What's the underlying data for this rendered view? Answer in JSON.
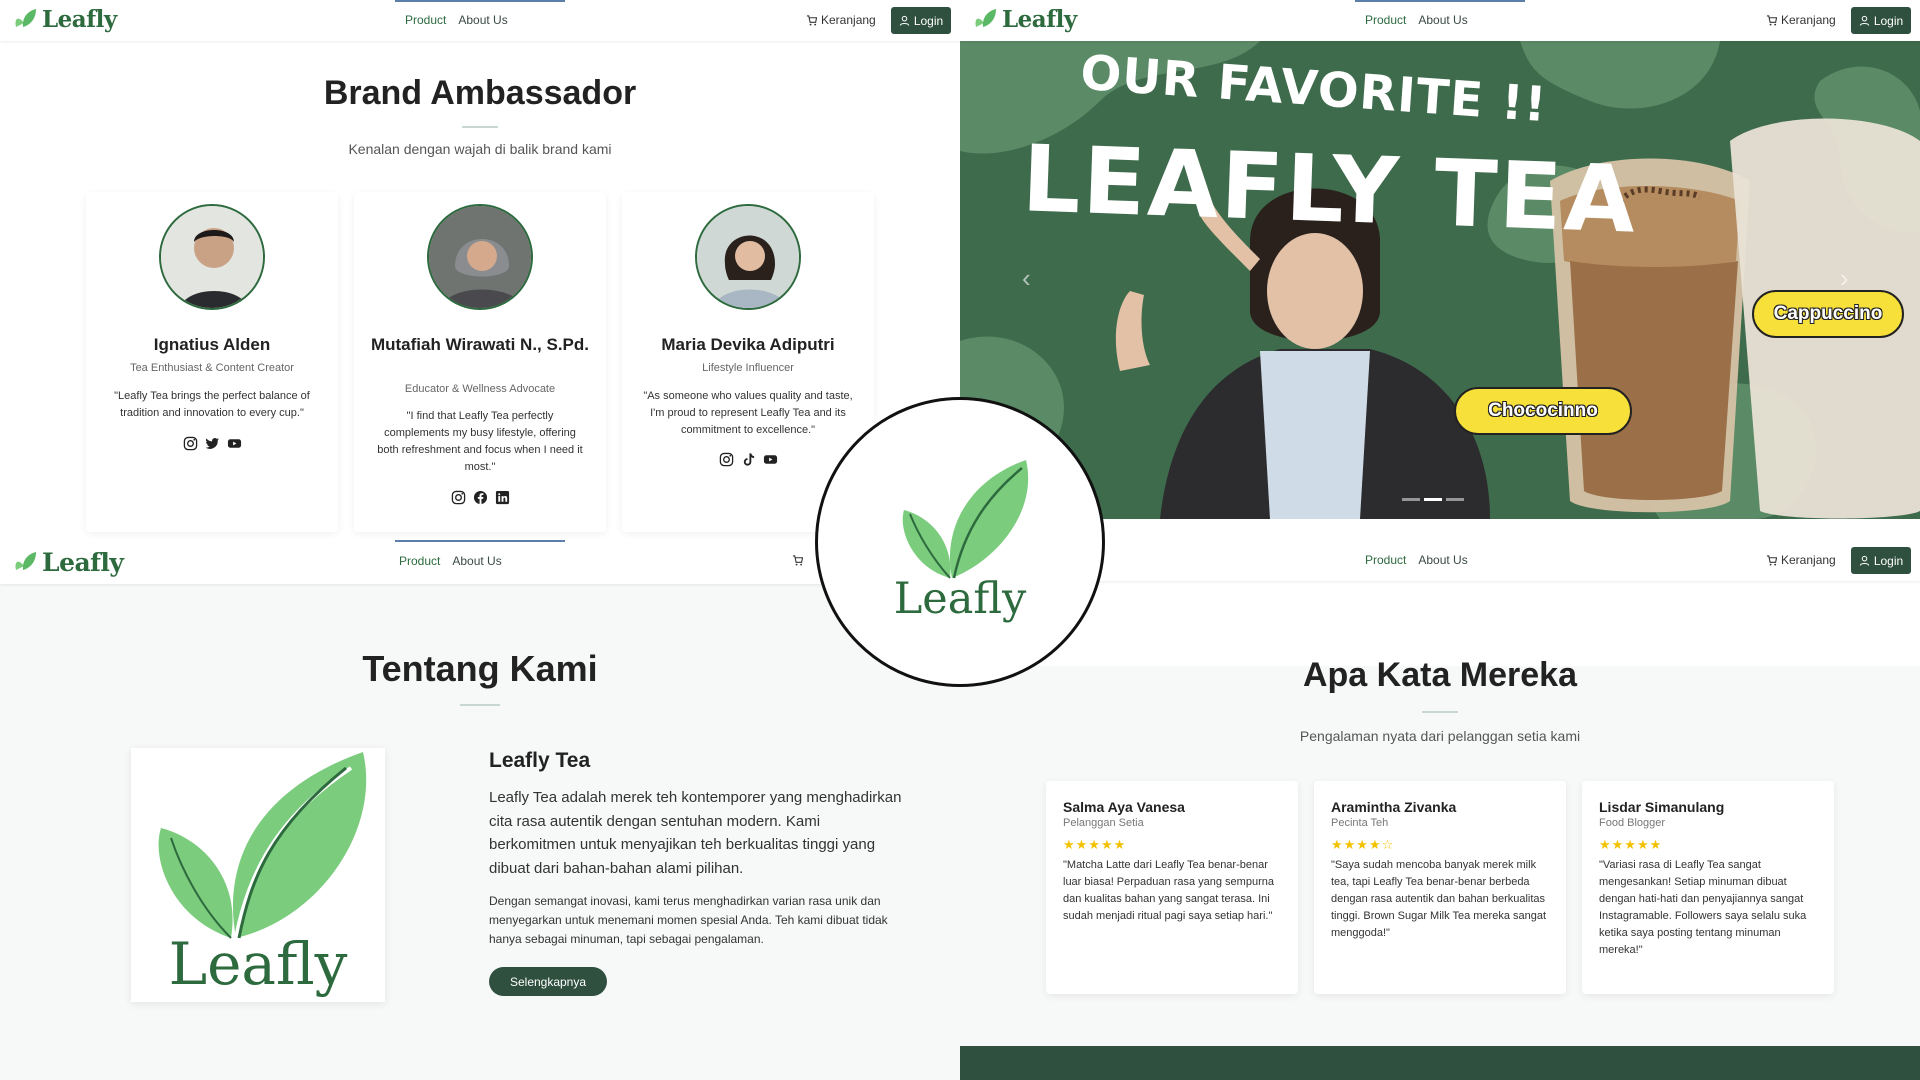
{
  "nav": {
    "brand": "Leafly",
    "menu": [
      "Product",
      "About Us"
    ],
    "cart": "Keranjang",
    "login": "Login"
  },
  "ambassador": {
    "title": "Brand Ambassador",
    "subtitle": "Kenalan dengan wajah di balik brand kami",
    "people": [
      {
        "name": "Ignatius Alden",
        "role": "Tea Enthusiast & Content Creator",
        "quote": "\"Leafly Tea brings the perfect balance of tradition and innovation to every cup.\"",
        "socials": [
          "instagram-icon",
          "twitter-icon",
          "youtube-icon"
        ]
      },
      {
        "name": "Mutafiah Wirawati N., S.Pd.",
        "role": "Educator & Wellness Advocate",
        "quote": "\"I find that Leafly Tea perfectly complements my busy lifestyle, offering both refreshment and focus when I need it most.\"",
        "socials": [
          "instagram-icon",
          "facebook-icon",
          "linkedin-icon"
        ]
      },
      {
        "name": "Maria Devika Adiputri",
        "role": "Lifestyle Influencer",
        "quote": "\"As someone who values quality and taste, I'm proud to represent Leafly Tea and its commitment to excellence.\"",
        "socials": [
          "instagram-icon",
          "tiktok-icon",
          "youtube-icon"
        ]
      }
    ]
  },
  "hero": {
    "line1": "OUR FAVORITE !!",
    "line2": "LEAFLY TEA",
    "pill_right": "Cappuccino",
    "pill_left": "Chococinno",
    "slide_index": 2,
    "slide_count": 3,
    "colors": {
      "bg": "#3e6b4c",
      "pill": "#f7e03a"
    }
  },
  "about": {
    "title": "Tentang Kami",
    "heading": "Leafly Tea",
    "p1": "Leafly Tea adalah merek teh kontemporer yang menghadirkan cita rasa autentik dengan sentuhan modern. Kami berkomitmen untuk menyajikan teh berkualitas tinggi yang dibuat dari bahan-bahan alami pilihan.",
    "p2": "Dengan semangat inovasi, kami terus menghadirkan varian rasa unik dan menyegarkan untuk menemani momen spesial Anda. Teh kami dibuat tidak hanya sebagai minuman, tapi sebagai pengalaman.",
    "button": "Selengkapnya",
    "logo_word": "Leafly"
  },
  "testimonials": {
    "title": "Apa Kata Mereka",
    "subtitle": "Pengalaman nyata dari pelanggan setia kami",
    "items": [
      {
        "name": "Salma Aya Vanesa",
        "role": "Pelanggan Setia",
        "stars": "★★★★★",
        "rating": 5,
        "text": "\"Matcha Latte dari Leafly Tea benar-benar luar biasa! Perpaduan rasa yang sempurna dan kualitas bahan yang sangat terasa. Ini sudah menjadi ritual pagi saya setiap hari.\""
      },
      {
        "name": "Aramintha Zivanka",
        "role": "Pecinta Teh",
        "stars": "★★★★☆",
        "rating": 4.5,
        "text": "\"Saya sudah mencoba banyak merek milk tea, tapi Leafly Tea benar-benar berbeda dengan rasa autentik dan bahan berkualitas tinggi. Brown Sugar Milk Tea mereka sangat menggoda!\""
      },
      {
        "name": "Lisdar Simanulang",
        "role": "Food Blogger",
        "stars": "★★★★★",
        "rating": 5,
        "text": "\"Variasi rasa di Leafly Tea sangat mengesankan! Setiap minuman dibuat dengan hati-hati dan penyajiannya sangat Instagramable. Followers saya selalu suka ketika saya posting tentang minuman mereka!\""
      }
    ]
  },
  "center_logo": {
    "word": "Leafly"
  },
  "colors": {
    "brand_green": "#2d6a3e",
    "dark_green": "#2f4f3f",
    "leaf_light": "#7ccc7e",
    "star": "#f2c200"
  }
}
